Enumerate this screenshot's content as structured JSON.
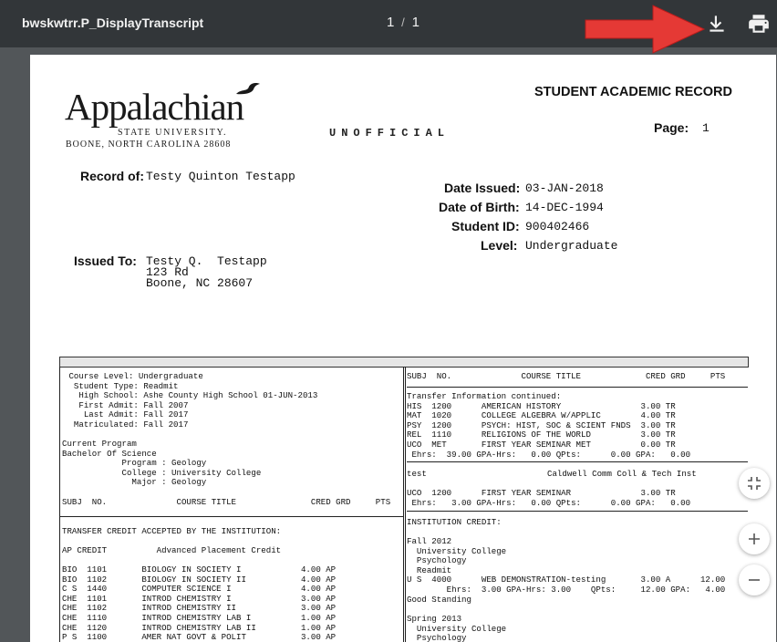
{
  "toolbar": {
    "title": "bwskwtrr.P_DisplayTranscript",
    "current_page": "1",
    "separator": "/",
    "total_pages": "1",
    "download_icon": "download-icon",
    "print_icon": "print-icon"
  },
  "colors": {
    "toolbar_bg": "#323639",
    "viewer_bg": "#525659",
    "arrow_red": "#e53935"
  },
  "header": {
    "logo_name": "Appalachian",
    "logo_sub": "STATE UNIVERSITY.",
    "logo_city": "BOONE, NORTH CAROLINA 28608",
    "unofficial": "UNOFFICIAL",
    "title": "STUDENT ACADEMIC RECORD",
    "page_label": "Page:",
    "page_number": "1"
  },
  "record": {
    "record_of_label": "Record of:",
    "record_of": "Testy Quinton Testapp",
    "date_issued_label": "Date Issued:",
    "date_issued": "03-JAN-2018",
    "dob_label": "Date of Birth:",
    "dob": "14-DEC-1994",
    "student_id_label": "Student ID:",
    "student_id": "900402466",
    "level_label": "Level:",
    "level": "Undergraduate",
    "issued_to_label": "Issued To:",
    "issued_to_name": "Testy Q.  Testapp",
    "address_1": "123 Rd",
    "address_2": "Boone, NC 28607"
  },
  "left_column": {
    "block_info": " Course Level: Undergraduate\n  Student Type: Readmit\n   High School: Ashe County High School 01-JUN-2013\n   First Admit: Fall 2007\n    Last Admit: Fall 2017\n  Matriculated: Fall 2017",
    "block_program": "Current Program\nBachelor Of Science\n            Program : Geology\n            College : University College\n              Major : Geology",
    "col_header": "SUBJ  NO.              COURSE TITLE               CRED GRD     PTS",
    "transfer_heading": "TRANSFER CREDIT ACCEPTED BY THE INSTITUTION:",
    "ap_heading": "AP CREDIT          Advanced Placement Credit",
    "courses": [
      "BIO  1101       BIOLOGY IN SOCIETY I            4.00 AP",
      "BIO  1102       BIOLOGY IN SOCIETY II           4.00 AP",
      "C S  1440       COMPUTER SCIENCE I              4.00 AP",
      "CHE  1101       INTROD CHEMISTRY I              3.00 AP",
      "CHE  1102       INTROD CHEMISTRY II             3.00 AP",
      "CHE  1110       INTROD CHEMISTRY LAB I          1.00 AP",
      "CHE  1120       INTROD CHEMISTRY LAB II         1.00 AP",
      "P S  1100       AMER NAT GOVT & POLIT           3.00 AP"
    ]
  },
  "right_column": {
    "col_header": "SUBJ  NO.              COURSE TITLE             CRED GRD     PTS",
    "transfer_continued": "Transfer Information continued:",
    "transfer_rows": [
      "HIS  1200      AMERICAN HISTORY                3.00 TR",
      "MAT  1020      COLLEGE ALGEBRA W/APPLIC        4.00 TR",
      "PSY  1200      PSYCH: HIST, SOC & SCIENT FNDS  3.00 TR",
      "REL  1110      RELIGIONS OF THE WORLD          3.00 TR",
      "UCO  MET       FIRST YEAR SEMINAR MET          0.00 TR"
    ],
    "transfer_totals": " Ehrs:  39.00 GPA-Hrs:   0.00 QPts:      0.00 GPA:   0.00",
    "test_label": "test",
    "test_inst": "Caldwell Comm Coll & Tech Inst",
    "test_row": "UCO  1200      FIRST YEAR SEMINAR              3.00 TR",
    "test_totals": " Ehrs:   3.00 GPA-Hrs:   0.00 QPts:      0.00 GPA:   0.00",
    "institution_heading": "INSTITUTION CREDIT:",
    "term1": "Fall 2012\n  University College\n  Psychology\n  Readmit",
    "term1_row": "U S  4000      WEB DEMONSTRATION-testing       3.00 A      12.00",
    "term1_totals": "        Ehrs:  3.00 GPA-Hrs: 3.00    QPts:     12.00 GPA:   4.00",
    "standing": "Good Standing",
    "term2": "Spring 2013\n  University College\n  Psychology"
  }
}
